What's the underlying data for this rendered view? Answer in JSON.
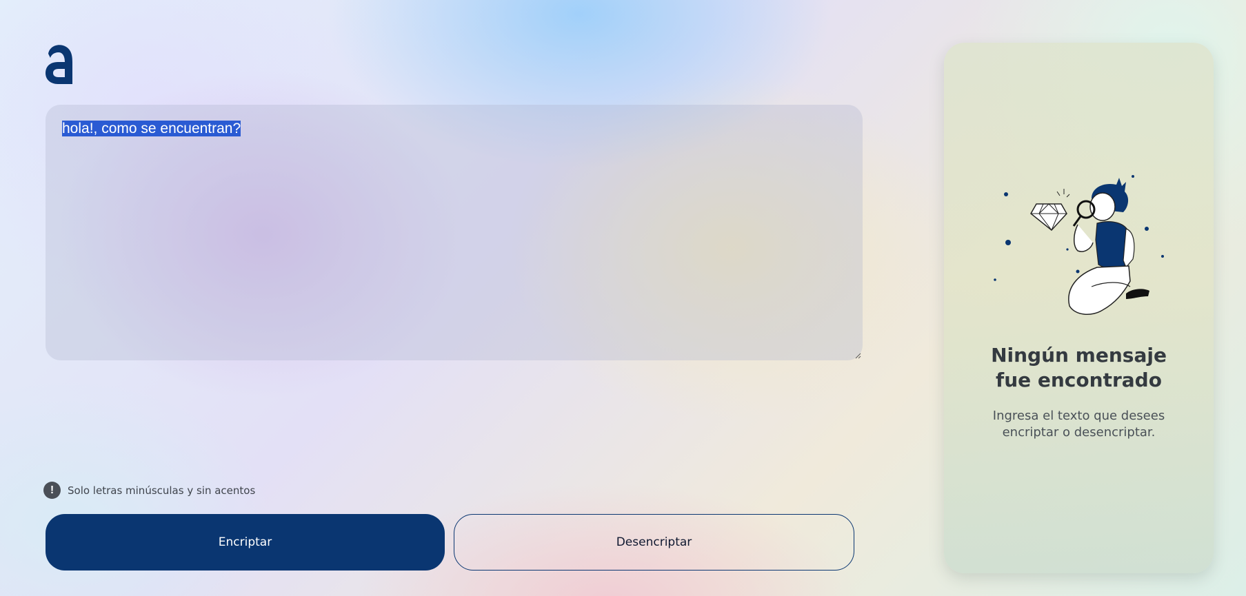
{
  "logo": {
    "letter": "a"
  },
  "input": {
    "value": "hola!, como se encuentran?"
  },
  "notice": {
    "icon": "info-icon",
    "text": "Solo letras minúsculas y sin acentos"
  },
  "buttons": {
    "encrypt_label": "Encriptar",
    "decrypt_label": "Desencriptar"
  },
  "panel": {
    "title_line1": "Ningún mensaje",
    "title_line2": "fue encontrado",
    "subtitle_line1": "Ingresa el texto que desees",
    "subtitle_line2": "encriptar o desencriptar."
  },
  "colors": {
    "accent": "#0a3671",
    "selection": "#2a5bd3",
    "text_dark": "#343a40",
    "text_muted": "#495057"
  }
}
